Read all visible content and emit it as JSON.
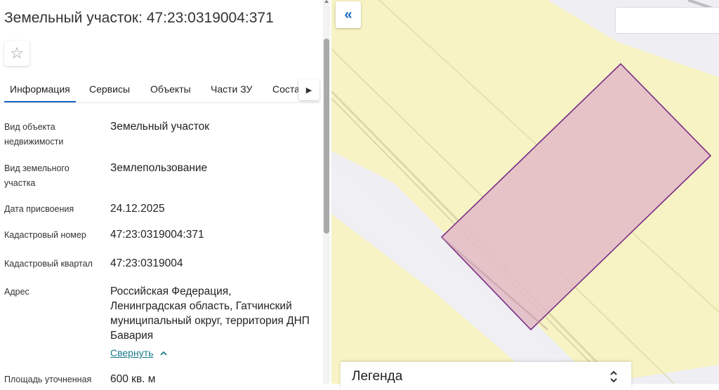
{
  "header": {
    "title": "Земельный участок: 47:23:0319004:371"
  },
  "favorite": {
    "icon": "star-outline-icon",
    "glyph": "☆"
  },
  "tabs": [
    {
      "label": "Информация",
      "active": true
    },
    {
      "label": "Сервисы"
    },
    {
      "label": "Объекты"
    },
    {
      "label": "Части ЗУ"
    },
    {
      "label": "Соста"
    }
  ],
  "tab_next": {
    "icon": "chevron-right-icon",
    "glyph": "▶"
  },
  "info": {
    "object_type": {
      "label": "Вид объекта недвижимости",
      "value": "Земельный участок"
    },
    "land_type": {
      "label": "Вид земельного участка",
      "value": "Землепользование"
    },
    "date": {
      "label": "Дата присвоения",
      "value": "24.12.2025"
    },
    "cadastral_number": {
      "label": "Кадастровый номер",
      "value": "47:23:0319004:371"
    },
    "cadastral_quarter": {
      "label": "Кадастровый квартал",
      "value": "47:23:0319004"
    },
    "address": {
      "label": "Адрес",
      "value": "Российская Федерация, Ленинградская область, Гатчинский муниципальный округ, территория ДНП Бавария"
    },
    "area": {
      "label": "Площадь уточненная",
      "value": "600 кв. м"
    }
  },
  "collapse_link": "Свернуть",
  "map": {
    "collapse_panel_glyph": "«",
    "legend_label": "Легенда",
    "colors": {
      "background": "#f7f3c4",
      "parcel_fill": "#e3bcc6",
      "parcel_stroke": "#7a2a86",
      "road": "#eeeef3"
    }
  }
}
